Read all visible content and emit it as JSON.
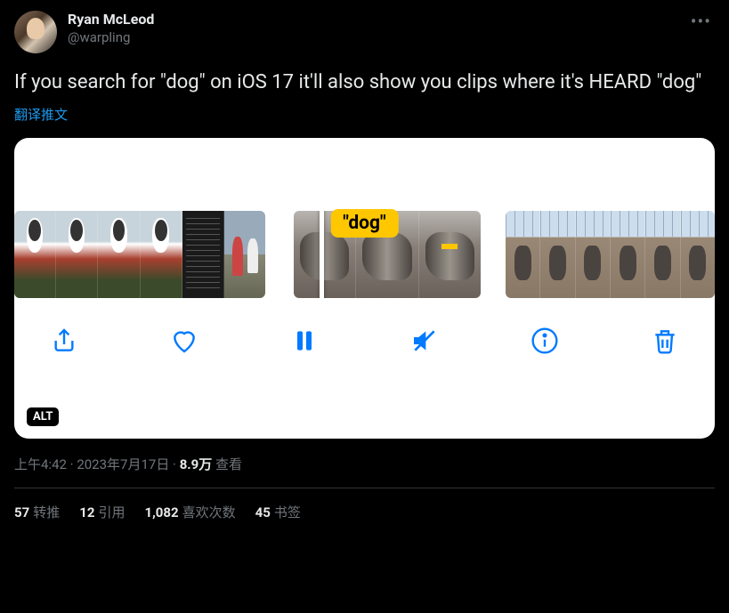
{
  "user": {
    "display_name": "Ryan McLeod",
    "handle": "@warpling"
  },
  "tweet_text": "If you search for \"dog\" on iOS 17 it'll also show you clips where it's HEARD \"dog\"",
  "translate_label": "翻译推文",
  "media": {
    "caption_label": "\"dog\"",
    "alt_badge": "ALT"
  },
  "meta": {
    "time": "上午4:42",
    "dot1": " · ",
    "date": "2023年7月17日",
    "dot2": " · ",
    "views_num": "8.9万",
    "views_label": " 查看"
  },
  "stats": {
    "retweets_num": "57",
    "retweets_label": "转推",
    "quotes_num": "12",
    "quotes_label": "引用",
    "likes_num": "1,082",
    "likes_label": "喜欢次数",
    "bookmarks_num": "45",
    "bookmarks_label": "书签"
  }
}
